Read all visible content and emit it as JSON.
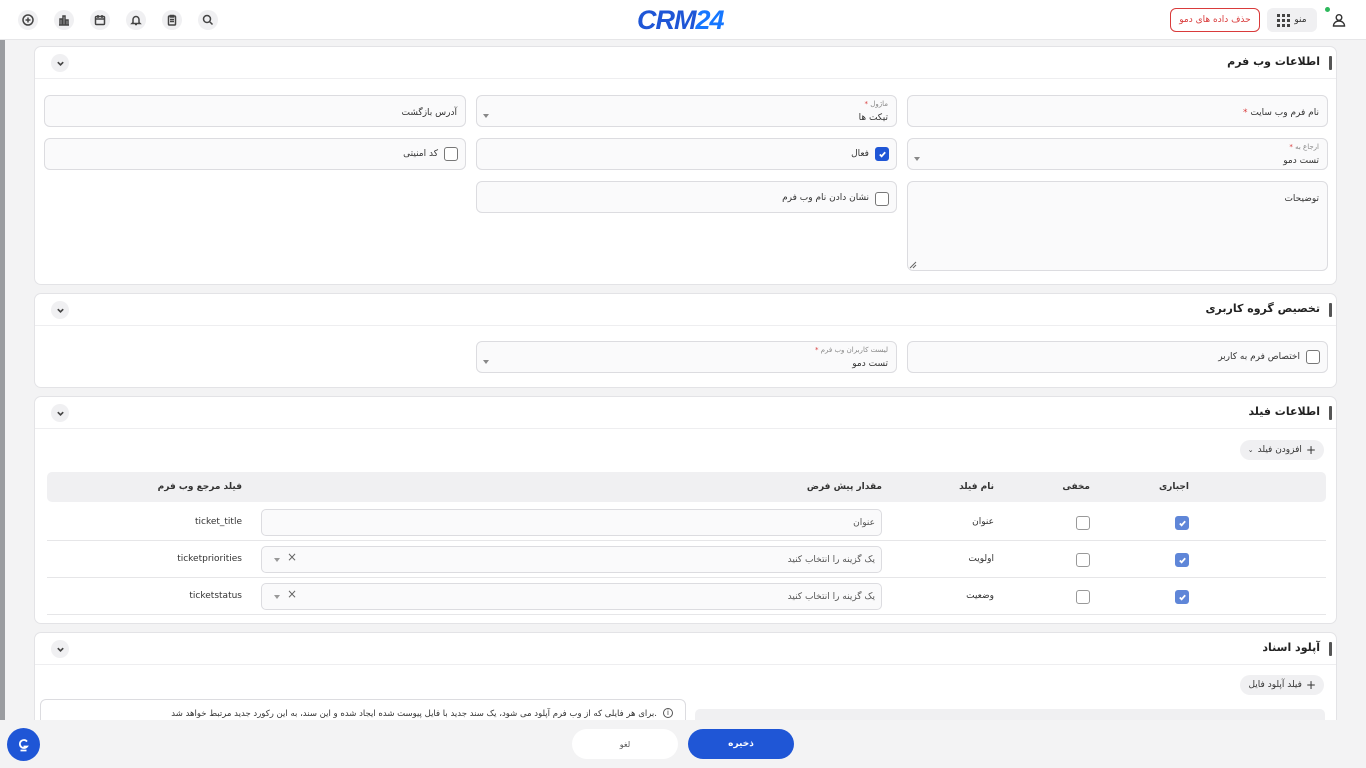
{
  "app": {
    "logo_left": "CRM",
    "logo_right": "24",
    "demo_delete_label": "حذف داده های دمو",
    "menu_label": "منو"
  },
  "webform_section": {
    "title": "اطلاعات وب فرم",
    "site_form_name_label": "نام فرم وب سایت",
    "module_label": "ماژول",
    "module_value": "تیکت ها",
    "return_address_label": "آدرس بازگشت",
    "assign_to_label": "ارجاع به",
    "assign_to_value": "تست دمو",
    "active_label": "فعال",
    "security_code_label": "کد امنیتی",
    "description_label": "توضیحات",
    "show_name_label": "نشان دادن نام وب فرم"
  },
  "user_group_section": {
    "title": "تخصیص گروه کاربری",
    "assign_form_label": "اختصاص فرم به کاربر",
    "users_list_label": "لیست کاربران وب فرم",
    "users_list_value": "تست دمو"
  },
  "field_section": {
    "title": "اطلاعات فیلد",
    "add_field_label": "افزودن فیلد",
    "columns": {
      "required": "اجباری",
      "hidden": "مخفی",
      "field_name": "نام فیلد",
      "default_value": "مقدار پیش فرض",
      "reference_field": "فیلد مرجع وب فرم"
    },
    "rows": [
      {
        "required": true,
        "hidden": false,
        "field_name": "عنوان",
        "default_value": "عنوان",
        "reference_field": "ticket_title",
        "select": false
      },
      {
        "required": true,
        "hidden": false,
        "field_name": "اولویت",
        "default_value": "یک گزینه را انتخاب کنید",
        "reference_field": "ticketpriorities",
        "select": true
      },
      {
        "required": true,
        "hidden": false,
        "field_name": "وضعیت",
        "default_value": "یک گزینه را انتخاب کنید",
        "reference_field": "ticketstatus",
        "select": true
      }
    ]
  },
  "upload_section": {
    "title": "آپلود اسناد",
    "upload_field_label": "فیلد آپلود فایل",
    "info_text": "برای هر فایلی که از وب فرم آپلود می شود، یک سند جدید با فایل پیوست شده ایجاد شده و این سند، به این رکورد جدید مرتبط خواهد شد."
  },
  "footer": {
    "save_label": "ذخیره",
    "cancel_label": "لغو"
  },
  "colors": {
    "primary": "#1f56d6",
    "danger": "#d93b3b",
    "online": "#2eb85c"
  }
}
